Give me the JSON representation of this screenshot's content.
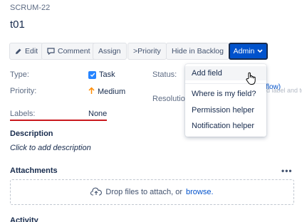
{
  "issue": {
    "key": "SCRUM-22",
    "title": "t01"
  },
  "toolbar": {
    "edit": "Edit",
    "comment": "Comment",
    "assign": "Assign",
    "priority": ">Priority",
    "hide_backlog": "Hide in Backlog",
    "admin": "Admin"
  },
  "details": {
    "type_label": "Type:",
    "type_value": "Task",
    "priority_label": "Priority:",
    "priority_value": "Medium",
    "labels_label": "Labels:",
    "labels_value": "None",
    "status_label": "Status:",
    "resolution_label": "Resolution",
    "status_partial": "flow)",
    "behind_text": "add label and to b"
  },
  "description": {
    "heading": "Description",
    "placeholder": "Click to add description"
  },
  "attachments": {
    "heading": "Attachments",
    "drop_text": "Drop files to attach, or",
    "browse": "browse."
  },
  "activity": {
    "heading": "Activity"
  },
  "admin_menu": {
    "items": [
      "Add field",
      "Where is my field?",
      "Permission helper",
      "Notification helper"
    ]
  },
  "colors": {
    "admin_bg": "#0052cc",
    "task_icon": "#2684ff",
    "priority_medium": "#ff8b00",
    "labels_underline": "#c9181d",
    "link": "#0052cc"
  },
  "icons": [
    "pencil-icon",
    "comment-icon",
    "chevron-down-icon",
    "checkbox-icon",
    "arrow-up-icon",
    "more-icon",
    "cloud-upload-icon",
    "hand-cursor-icon"
  ]
}
